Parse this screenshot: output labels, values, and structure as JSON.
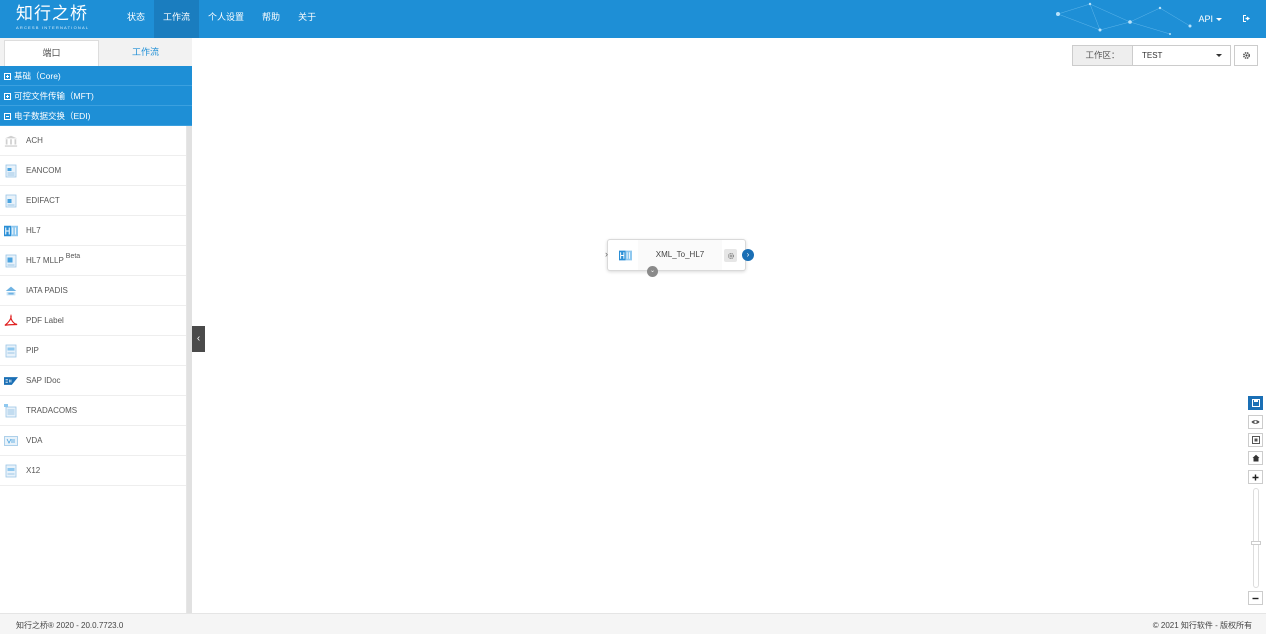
{
  "brand": {
    "name_cn": "知行之桥",
    "name_en": "ARCESB INTERNATIONAL"
  },
  "nav": {
    "items": [
      {
        "label": "状态"
      },
      {
        "label": "工作流"
      },
      {
        "label": "个人设置"
      },
      {
        "label": "帮助"
      },
      {
        "label": "关于"
      }
    ],
    "active_index": 1,
    "api_label": "API"
  },
  "left_panel": {
    "tabs": [
      {
        "label": "端口"
      },
      {
        "label": "工作流"
      }
    ],
    "active_tab_index": 0,
    "groups": [
      {
        "label": "基础（Core)",
        "expanded": false
      },
      {
        "label": "可控文件传输（MFT)",
        "expanded": false
      },
      {
        "label": "电子数据交换（EDI)",
        "expanded": true
      }
    ],
    "connectors": [
      {
        "label": "ACH",
        "icon": "bank-icon"
      },
      {
        "label": "EANCOM",
        "icon": "document-icon"
      },
      {
        "label": "EDIFACT",
        "icon": "document-icon"
      },
      {
        "label": "HL7",
        "icon": "hl7-icon"
      },
      {
        "label": "HL7 MLLP",
        "badge": "Beta",
        "icon": "document-icon"
      },
      {
        "label": "IATA PADIS",
        "icon": "iata-icon"
      },
      {
        "label": "PDF Label",
        "icon": "pdf-icon"
      },
      {
        "label": "PIP",
        "icon": "document-icon"
      },
      {
        "label": "SAP IDoc",
        "icon": "sap-icon"
      },
      {
        "label": "TRADACOMS",
        "icon": "document-icon"
      },
      {
        "label": "VDA",
        "icon": "vda-icon"
      },
      {
        "label": "X12",
        "icon": "document-icon"
      }
    ]
  },
  "workspace": {
    "label": "工作区：",
    "value": "TEST"
  },
  "canvas": {
    "node": {
      "label": "XML_To_HL7",
      "icon": "hl7-icon"
    }
  },
  "footer": {
    "left": "知行之桥® 2020 - 20.0.7723.0",
    "right": "© 2021 知行软件 - 版权所有"
  },
  "colors": {
    "primary": "#1e8fd6",
    "nav_active": "#1a7dbf",
    "accent_dark": "#1a6fb5",
    "pdf_red": "#e02020"
  }
}
